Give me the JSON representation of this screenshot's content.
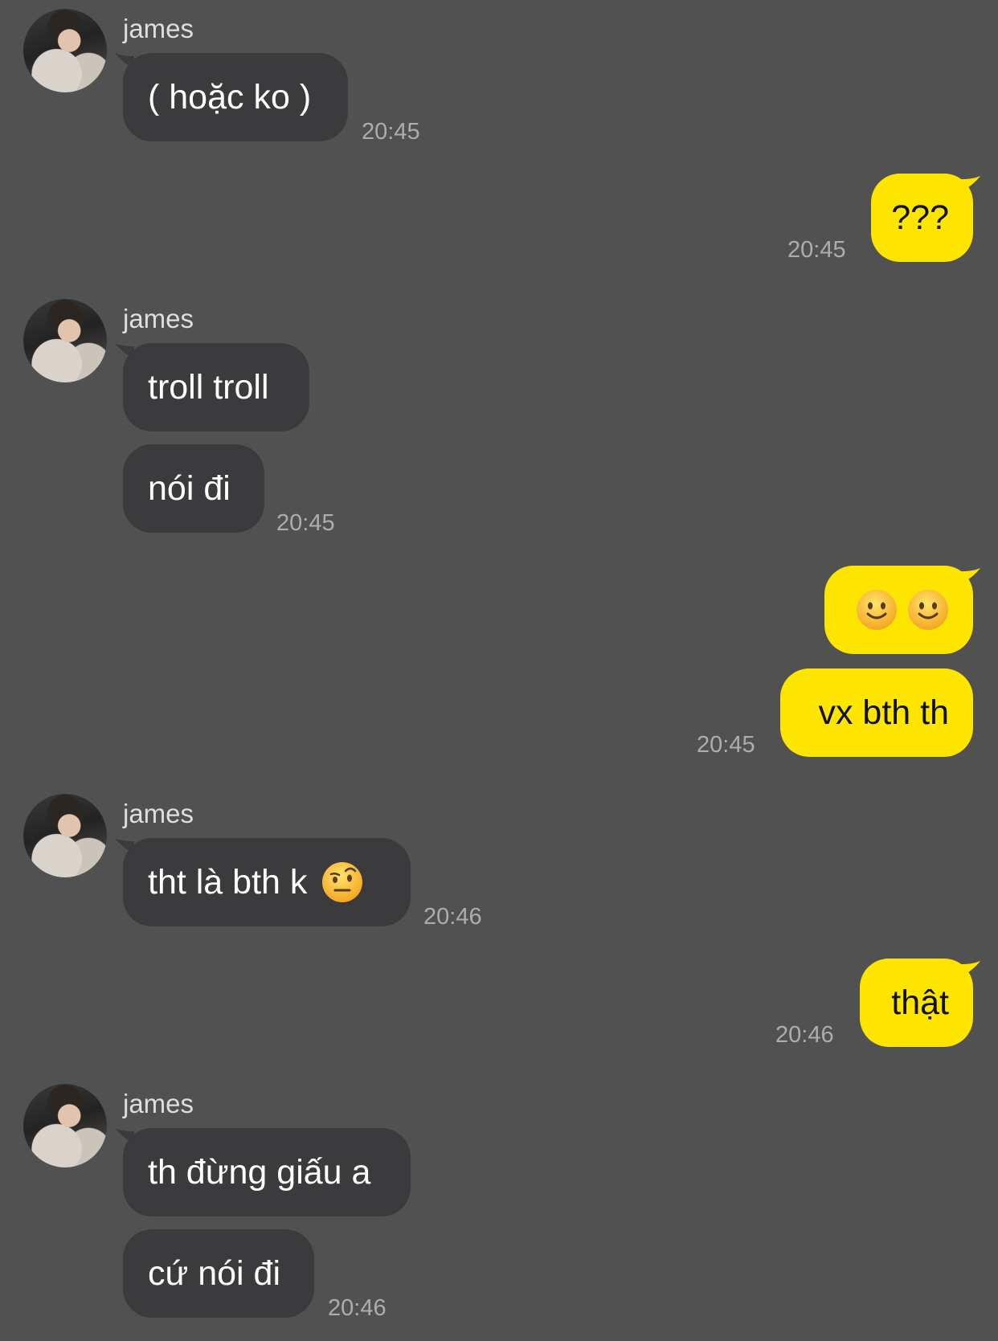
{
  "theme": {
    "background": "#525152",
    "incoming_bubble": "#3b3a3c",
    "outgoing_bubble": "#fee500",
    "time_color": "#aeadad"
  },
  "messages": [
    {
      "sender": "james",
      "text": "( hoặc ko )",
      "time": "20:45"
    },
    {
      "sender": "me",
      "text": "???",
      "time": "20:45"
    },
    {
      "sender": "james",
      "text": "troll troll"
    },
    {
      "sender": "james",
      "text": "nói đi",
      "time": "20:45"
    },
    {
      "sender": "me",
      "text": "",
      "emojis": [
        "slightly-smiling-face-emoji",
        "slightly-smiling-face-emoji"
      ]
    },
    {
      "sender": "me",
      "text": "vx bth th",
      "time": "20:45"
    },
    {
      "sender": "james",
      "text": "tht là bth k",
      "emoji": "face-with-raised-eyebrow-emoji",
      "time": "20:46"
    },
    {
      "sender": "me",
      "text": "thật",
      "time": "20:46"
    },
    {
      "sender": "james",
      "text": "th đừng giấu a"
    },
    {
      "sender": "james",
      "text": "cứ nói đi",
      "time": "20:46"
    }
  ]
}
